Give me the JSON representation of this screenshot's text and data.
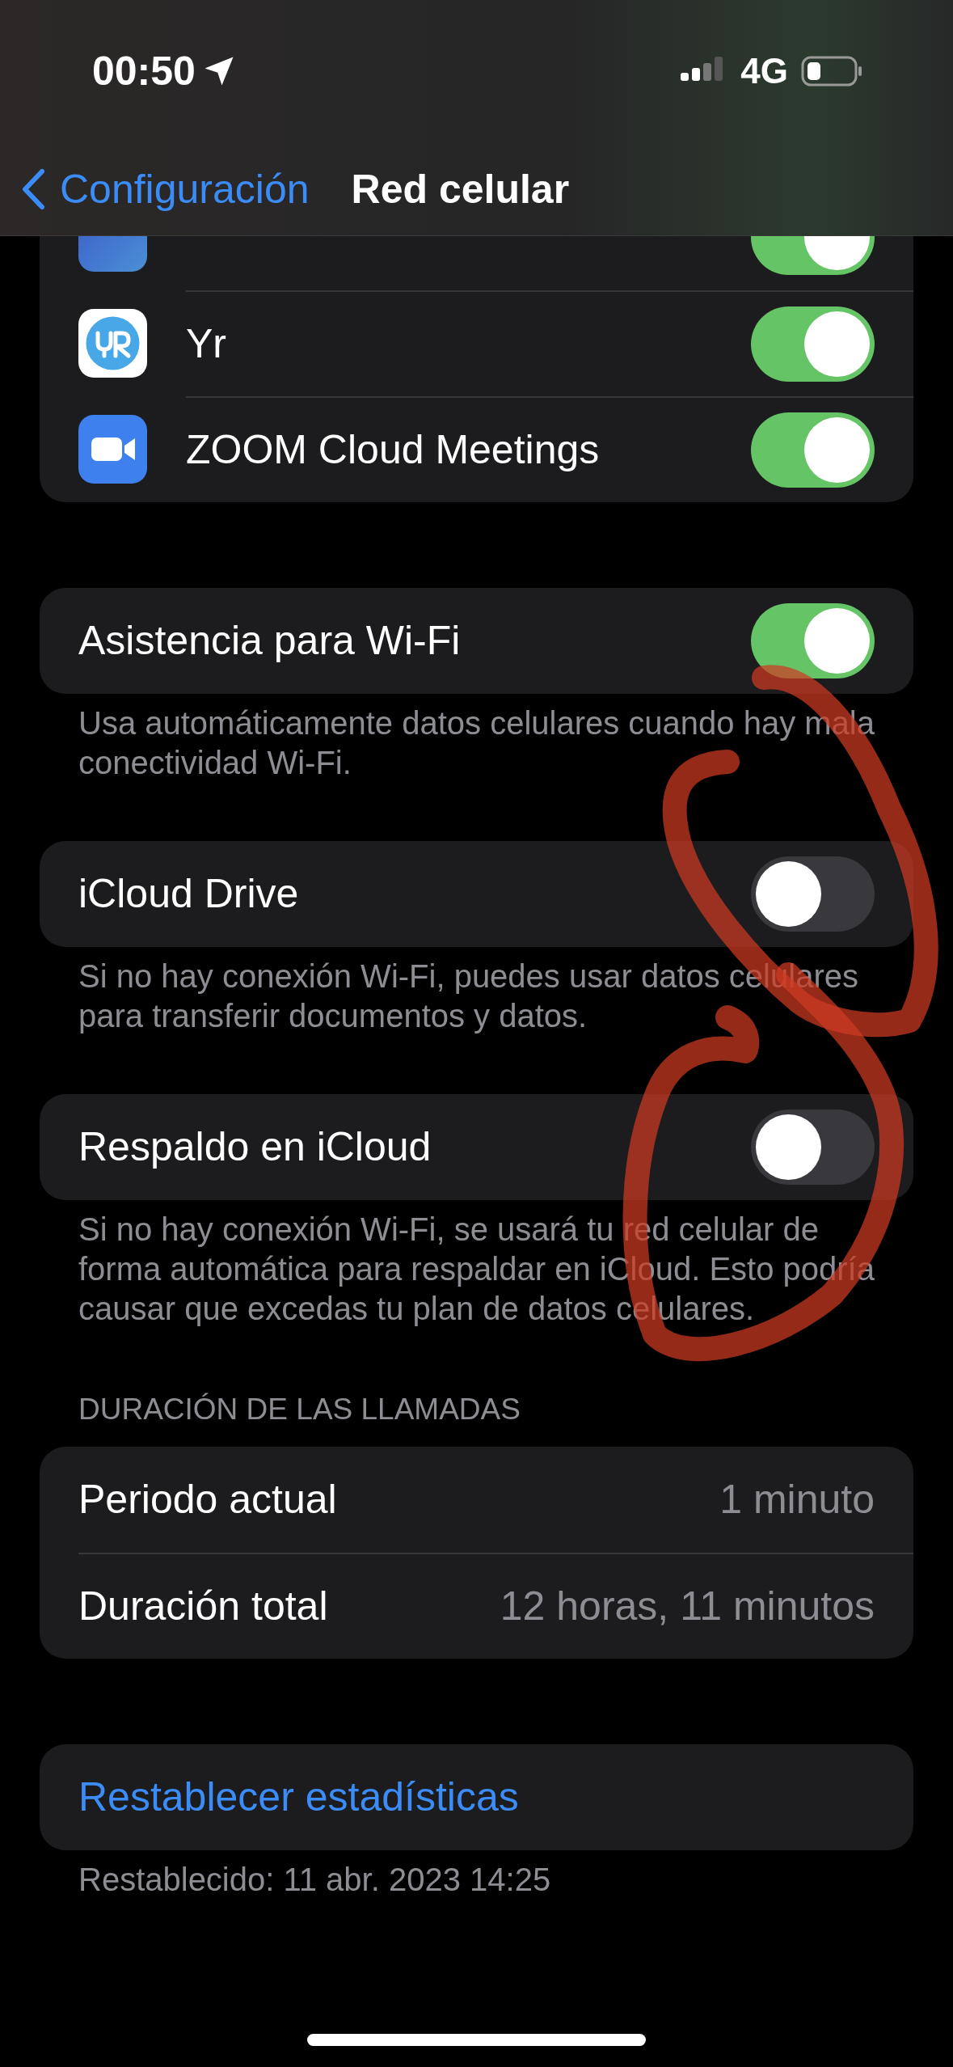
{
  "status_bar": {
    "time": "00:50",
    "network": "4G"
  },
  "nav": {
    "back": "Configuración",
    "title": "Red celular"
  },
  "apps": [
    {
      "kind": "gradient",
      "on": true
    },
    {
      "name": "Yr",
      "kind": "yr",
      "on": true
    },
    {
      "name": "ZOOM Cloud Meetings",
      "kind": "zoom",
      "on": true
    }
  ],
  "settings": [
    {
      "label": "Asistencia para Wi-Fi",
      "on": true,
      "footer": "Usa automáticamente datos celulares cuando hay mala conectividad Wi-Fi."
    },
    {
      "label": "iCloud Drive",
      "on": false,
      "footer": "Si no hay conexión Wi-Fi, puedes usar datos celulares para transferir documentos y datos."
    },
    {
      "label": "Respaldo en iCloud",
      "on": false,
      "footer": "Si no hay conexión Wi-Fi, se usará tu red celular de forma automática para respaldar en iCloud. Esto podría causar que excedas tu plan de datos celulares."
    }
  ],
  "calls": {
    "header": "DURACIÓN DE LAS LLAMADAS",
    "rows": [
      {
        "label": "Periodo actual",
        "value": "1 minuto"
      },
      {
        "label": "Duración total",
        "value": "12 horas, 11 minutos"
      }
    ]
  },
  "reset": {
    "button": "Restablecer estadísticas",
    "footer": "Restablecido: 11 abr. 2023 14:25"
  }
}
